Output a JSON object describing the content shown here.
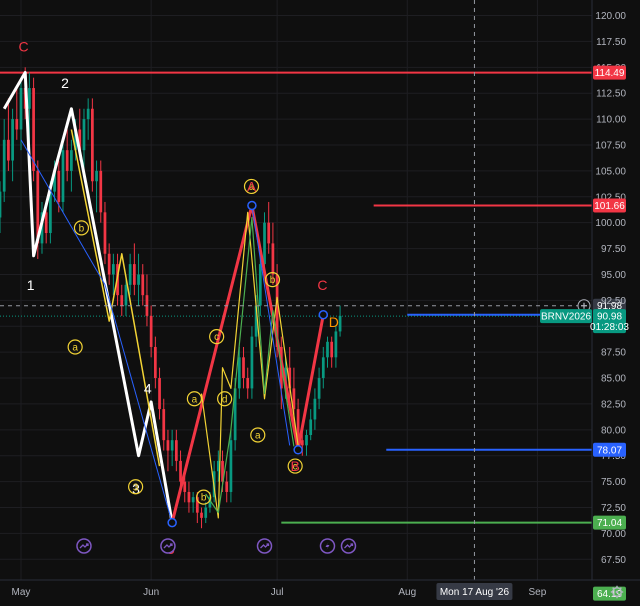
{
  "chart_data": {
    "type": "candlestick",
    "symbol": "BRNV2026",
    "y_ticks": [
      "120.00",
      "117.50",
      "115.00",
      "112.50",
      "110.00",
      "107.50",
      "105.00",
      "102.50",
      "100.00",
      "97.50",
      "95.00",
      "92.50",
      "90.00",
      "87.50",
      "85.00",
      "82.50",
      "80.00",
      "77.50",
      "75.00",
      "72.50",
      "70.00",
      "67.50"
    ],
    "ylim": [
      65.5,
      121.5
    ],
    "x_ticks": [
      {
        "label": "May",
        "day": 0
      },
      {
        "label": "Jun",
        "day": 31
      },
      {
        "label": "Jul",
        "day": 61
      },
      {
        "label": "Aug",
        "day": 92
      },
      {
        "label": "Sep",
        "day": 123
      }
    ],
    "xlim_days": [
      -5,
      136
    ],
    "crosshair": {
      "date_label": "Mon 17 Aug '26",
      "day": 108,
      "price": 91.98,
      "price_label": "91.98"
    },
    "last_price": {
      "value": 90.98,
      "label": "90.98",
      "countdown": "01:28:03",
      "color": "#089981"
    },
    "level_lines": [
      {
        "value": 114.49,
        "label": "114.49",
        "color": "#f23645",
        "start_day": -5
      },
      {
        "value": 101.66,
        "label": "101.66",
        "color": "#f23645",
        "start_day": 84
      },
      {
        "value": 91.11,
        "label": "",
        "color": "#2962ff",
        "start_day": 92
      },
      {
        "value": 78.07,
        "label": "78.07",
        "color": "#2962ff",
        "start_day": 87
      },
      {
        "value": 71.04,
        "label": "71.04",
        "color": "#4caf50",
        "start_day": 62
      }
    ],
    "extra_price_tags": [
      {
        "value": 64.19,
        "label": "64.19",
        "color": "#4caf50"
      }
    ],
    "candles": [
      {
        "day": -5,
        "o": 100.5,
        "h": 104,
        "l": 99,
        "c": 103
      },
      {
        "day": -4,
        "o": 103,
        "h": 110,
        "l": 102,
        "c": 108
      },
      {
        "day": -3,
        "o": 108,
        "h": 112,
        "l": 105,
        "c": 106
      },
      {
        "day": -2,
        "o": 106,
        "h": 111,
        "l": 104,
        "c": 110
      },
      {
        "day": -1,
        "o": 110,
        "h": 113,
        "l": 108,
        "c": 109
      },
      {
        "day": 0,
        "o": 109,
        "h": 114,
        "l": 107,
        "c": 113
      },
      {
        "day": 1,
        "o": 113,
        "h": 115,
        "l": 110,
        "c": 111
      },
      {
        "day": 2,
        "o": 111,
        "h": 114.5,
        "l": 107,
        "c": 113
      },
      {
        "day": 3,
        "o": 113,
        "h": 114,
        "l": 104,
        "c": 105
      },
      {
        "day": 4,
        "o": 105,
        "h": 106,
        "l": 96.5,
        "c": 98
      },
      {
        "day": 5,
        "o": 98,
        "h": 102,
        "l": 97,
        "c": 101
      },
      {
        "day": 6,
        "o": 101,
        "h": 102,
        "l": 98,
        "c": 99
      },
      {
        "day": 7,
        "o": 99,
        "h": 104,
        "l": 98,
        "c": 103
      },
      {
        "day": 8,
        "o": 103,
        "h": 106,
        "l": 102,
        "c": 105
      },
      {
        "day": 9,
        "o": 105,
        "h": 106,
        "l": 101,
        "c": 102
      },
      {
        "day": 10,
        "o": 102,
        "h": 108,
        "l": 101,
        "c": 107
      },
      {
        "day": 11,
        "o": 107,
        "h": 109,
        "l": 104,
        "c": 105
      },
      {
        "day": 12,
        "o": 105,
        "h": 108,
        "l": 103,
        "c": 107
      },
      {
        "day": 13,
        "o": 107,
        "h": 110,
        "l": 106,
        "c": 109
      },
      {
        "day": 14,
        "o": 109,
        "h": 111,
        "l": 106,
        "c": 107
      },
      {
        "day": 15,
        "o": 107,
        "h": 111,
        "l": 105,
        "c": 110
      },
      {
        "day": 16,
        "o": 110,
        "h": 112,
        "l": 108,
        "c": 111
      },
      {
        "day": 17,
        "o": 111,
        "h": 112,
        "l": 103,
        "c": 104
      },
      {
        "day": 18,
        "o": 104,
        "h": 106,
        "l": 101,
        "c": 105
      },
      {
        "day": 19,
        "o": 105,
        "h": 106,
        "l": 100,
        "c": 101
      },
      {
        "day": 20,
        "o": 101,
        "h": 102,
        "l": 96,
        "c": 97
      },
      {
        "day": 21,
        "o": 97,
        "h": 98,
        "l": 94,
        "c": 95
      },
      {
        "day": 22,
        "o": 95,
        "h": 97,
        "l": 93,
        "c": 96
      },
      {
        "day": 23,
        "o": 96,
        "h": 97,
        "l": 92,
        "c": 93
      },
      {
        "day": 24,
        "o": 93,
        "h": 94,
        "l": 91,
        "c": 92
      },
      {
        "day": 25,
        "o": 92,
        "h": 95,
        "l": 91,
        "c": 94
      },
      {
        "day": 26,
        "o": 94,
        "h": 97,
        "l": 93,
        "c": 96
      },
      {
        "day": 27,
        "o": 96,
        "h": 98,
        "l": 93,
        "c": 94
      },
      {
        "day": 28,
        "o": 94,
        "h": 97,
        "l": 92,
        "c": 95
      },
      {
        "day": 29,
        "o": 95,
        "h": 96,
        "l": 92,
        "c": 93
      },
      {
        "day": 30,
        "o": 93,
        "h": 95,
        "l": 90,
        "c": 91
      },
      {
        "day": 31,
        "o": 91,
        "h": 92,
        "l": 87,
        "c": 88
      },
      {
        "day": 32,
        "o": 88,
        "h": 89,
        "l": 84,
        "c": 85
      },
      {
        "day": 33,
        "o": 85,
        "h": 86,
        "l": 81,
        "c": 82
      },
      {
        "day": 34,
        "o": 82,
        "h": 83,
        "l": 78,
        "c": 79
      },
      {
        "day": 35,
        "o": 79,
        "h": 80,
        "l": 76,
        "c": 78
      },
      {
        "day": 36,
        "o": 78,
        "h": 80,
        "l": 76.5,
        "c": 79
      },
      {
        "day": 37,
        "o": 79,
        "h": 80,
        "l": 76,
        "c": 77
      },
      {
        "day": 38,
        "o": 77,
        "h": 78,
        "l": 74,
        "c": 75
      },
      {
        "day": 39,
        "o": 75,
        "h": 76,
        "l": 73,
        "c": 74
      },
      {
        "day": 40,
        "o": 74,
        "h": 75,
        "l": 72,
        "c": 73
      },
      {
        "day": 41,
        "o": 73,
        "h": 74,
        "l": 72,
        "c": 73.5
      },
      {
        "day": 42,
        "o": 73.5,
        "h": 74,
        "l": 71,
        "c": 72
      },
      {
        "day": 43,
        "o": 72,
        "h": 72.5,
        "l": 70.5,
        "c": 71.5
      },
      {
        "day": 44,
        "o": 71.5,
        "h": 73,
        "l": 71,
        "c": 72.5
      },
      {
        "day": 45,
        "o": 72.5,
        "h": 74,
        "l": 72,
        "c": 73.5
      },
      {
        "day": 46,
        "o": 73.5,
        "h": 77,
        "l": 73,
        "c": 76
      },
      {
        "day": 47,
        "o": 76,
        "h": 78,
        "l": 75,
        "c": 77
      },
      {
        "day": 48,
        "o": 77,
        "h": 78,
        "l": 74,
        "c": 75
      },
      {
        "day": 49,
        "o": 75,
        "h": 76,
        "l": 73,
        "c": 74
      },
      {
        "day": 50,
        "o": 74,
        "h": 80,
        "l": 73,
        "c": 79
      },
      {
        "day": 51,
        "o": 79,
        "h": 85,
        "l": 78,
        "c": 84
      },
      {
        "day": 52,
        "o": 84,
        "h": 88,
        "l": 83,
        "c": 87
      },
      {
        "day": 53,
        "o": 87,
        "h": 88,
        "l": 84,
        "c": 85
      },
      {
        "day": 54,
        "o": 85,
        "h": 86,
        "l": 83,
        "c": 84
      },
      {
        "day": 55,
        "o": 84,
        "h": 90,
        "l": 83,
        "c": 89
      },
      {
        "day": 56,
        "o": 89,
        "h": 93,
        "l": 88,
        "c": 92
      },
      {
        "day": 57,
        "o": 92,
        "h": 97,
        "l": 91,
        "c": 96
      },
      {
        "day": 58,
        "o": 96,
        "h": 101,
        "l": 95,
        "c": 100
      },
      {
        "day": 59,
        "o": 100,
        "h": 102,
        "l": 97,
        "c": 98
      },
      {
        "day": 60,
        "o": 98,
        "h": 100,
        "l": 94,
        "c": 95
      },
      {
        "day": 61,
        "o": 95,
        "h": 96,
        "l": 87,
        "c": 88
      },
      {
        "day": 62,
        "o": 88,
        "h": 89,
        "l": 82,
        "c": 84
      },
      {
        "day": 63,
        "o": 84,
        "h": 87,
        "l": 83,
        "c": 86
      },
      {
        "day": 64,
        "o": 86,
        "h": 88,
        "l": 83,
        "c": 84
      },
      {
        "day": 65,
        "o": 84,
        "h": 86,
        "l": 81,
        "c": 82
      },
      {
        "day": 66,
        "o": 82,
        "h": 83,
        "l": 78,
        "c": 79
      },
      {
        "day": 67,
        "o": 79,
        "h": 80,
        "l": 77.5,
        "c": 78.5
      },
      {
        "day": 68,
        "o": 78.5,
        "h": 80,
        "l": 77.5,
        "c": 79.5
      },
      {
        "day": 69,
        "o": 79.5,
        "h": 82,
        "l": 79,
        "c": 81
      },
      {
        "day": 70,
        "o": 81,
        "h": 84,
        "l": 80,
        "c": 83
      },
      {
        "day": 71,
        "o": 83,
        "h": 86,
        "l": 82,
        "c": 85
      },
      {
        "day": 72,
        "o": 85,
        "h": 88,
        "l": 84,
        "c": 87
      },
      {
        "day": 73,
        "o": 87,
        "h": 89,
        "l": 86,
        "c": 88.5
      },
      {
        "day": 74,
        "o": 88.5,
        "h": 89,
        "l": 86,
        "c": 87
      },
      {
        "day": 75,
        "o": 87,
        "h": 90,
        "l": 86,
        "c": 89.5
      },
      {
        "day": 76,
        "o": 89.5,
        "h": 92,
        "l": 89,
        "c": 91
      }
    ],
    "overlay_lines": [
      {
        "name": "",
        "color": "#ffffff",
        "width": 3,
        "points": [
          [
            -4,
            111
          ],
          [
            1,
            114.5
          ],
          [
            3,
            96.8
          ],
          [
            8,
            105
          ],
          [
            12,
            111
          ],
          [
            28,
            77.5
          ],
          [
            31,
            82.7
          ],
          [
            36,
            71.04
          ]
        ]
      },
      {
        "name": "",
        "color": "#f23645",
        "width": 3,
        "points": [
          [
            36,
            71.04
          ],
          [
            55,
            101.66
          ],
          [
            66,
            78.07
          ],
          [
            72,
            91.11
          ]
        ]
      },
      {
        "name": "",
        "color": "#f2d335",
        "width": 1.5,
        "points": [
          [
            12,
            109
          ],
          [
            21,
            90.5
          ],
          [
            24,
            97
          ],
          [
            33,
            76.5
          ]
        ]
      },
      {
        "name": "",
        "color": "#f2d335",
        "width": 1.2,
        "points": [
          [
            43,
            83.5
          ],
          [
            47,
            71.5
          ],
          [
            48,
            86
          ],
          [
            50,
            84
          ],
          [
            54,
            101
          ],
          [
            58,
            83
          ],
          [
            61,
            92.8
          ],
          [
            66,
            78.5
          ]
        ]
      },
      {
        "name": "",
        "color": "#4caf50",
        "width": 1.2,
        "points": [
          [
            44,
            73.8
          ],
          [
            47,
            72
          ],
          [
            50,
            80
          ],
          [
            55,
            100.5
          ],
          [
            58,
            83.5
          ],
          [
            60,
            91.5
          ],
          [
            65,
            78.4
          ]
        ]
      },
      {
        "name": "",
        "color": "#2962ff",
        "width": 1,
        "points": [
          [
            0,
            108
          ],
          [
            20,
            94
          ],
          [
            36,
            71.04
          ]
        ]
      },
      {
        "name": "",
        "color": "#2962ff",
        "width": 1,
        "points": [
          [
            55,
            101.66
          ],
          [
            64,
            78.5
          ]
        ]
      }
    ],
    "wave_labels": [
      {
        "text": "C",
        "day": 0.6,
        "price": 117.0,
        "color": "#f23645",
        "style": "plain"
      },
      {
        "text": "1",
        "day": 2.3,
        "price": 94.0,
        "color": "#ffffff",
        "style": "plain"
      },
      {
        "text": "2",
        "day": 10.5,
        "price": 113.5,
        "color": "#ffffff",
        "style": "plain"
      },
      {
        "text": "3",
        "day": 27.4,
        "price": 74.3,
        "color": "#ffffff",
        "style": "plain"
      },
      {
        "text": "4",
        "day": 30.2,
        "price": 84.0,
        "color": "#ffffff",
        "style": "plain"
      },
      {
        "text": "5",
        "day": 35.7,
        "price": 68.5,
        "color": "#f23645",
        "style": "plain"
      },
      {
        "text": "b",
        "day": 14.4,
        "price": 99.5,
        "color": "#f2d335",
        "style": "circle"
      },
      {
        "text": "a",
        "day": 12.9,
        "price": 88.0,
        "color": "#f2d335",
        "style": "circle"
      },
      {
        "text": "3",
        "day": 27.3,
        "price": 74.5,
        "color": "#f2d335",
        "style": "circle"
      },
      {
        "text": "a",
        "day": 41.3,
        "price": 83.0,
        "color": "#f2d335",
        "style": "circle"
      },
      {
        "text": "b",
        "day": 43.5,
        "price": 73.5,
        "color": "#f2d335",
        "style": "circle"
      },
      {
        "text": "c",
        "day": 46.6,
        "price": 89.0,
        "color": "#f2d335",
        "style": "circle"
      },
      {
        "text": "d",
        "day": 48.5,
        "price": 83.0,
        "color": "#f2d335",
        "style": "circle"
      },
      {
        "text": "a",
        "day": 54.9,
        "price": 103.5,
        "color": "#f2d335",
        "style": "circle"
      },
      {
        "text": "A",
        "day": 54.9,
        "price": 103.5,
        "color": "#f23645",
        "style": "plain"
      },
      {
        "text": "b",
        "day": 59.9,
        "price": 94.5,
        "color": "#f2d335",
        "style": "circle"
      },
      {
        "text": "a",
        "day": 56.4,
        "price": 79.5,
        "color": "#f2d335",
        "style": "circle"
      },
      {
        "text": "c",
        "day": 65.3,
        "price": 76.5,
        "color": "#f2d335",
        "style": "circle"
      },
      {
        "text": "B",
        "day": 65.3,
        "price": 76.5,
        "color": "#f23645",
        "style": "plain"
      },
      {
        "text": "C",
        "day": 71.8,
        "price": 94.0,
        "color": "#f23645",
        "style": "plain"
      },
      {
        "text": "D",
        "day": 74.5,
        "price": 90.4,
        "color": "#ff9800",
        "style": "plain"
      }
    ],
    "pivot_dots": [
      {
        "day": 36,
        "price": 71.04
      },
      {
        "day": 55,
        "price": 101.66
      },
      {
        "day": 66,
        "price": 78.07
      },
      {
        "day": 72,
        "price": 91.11
      }
    ],
    "event_markers": [
      {
        "day": 15,
        "kind": "arrow"
      },
      {
        "day": 35,
        "kind": "arrow"
      },
      {
        "day": 58,
        "kind": "arrow"
      },
      {
        "day": 73,
        "kind": "flash"
      },
      {
        "day": 78,
        "kind": "arrow"
      }
    ]
  },
  "ui": {
    "gear_icon": "gear-icon",
    "plus_icon": "plus-icon",
    "event_icon_color": "#7e57c2"
  }
}
